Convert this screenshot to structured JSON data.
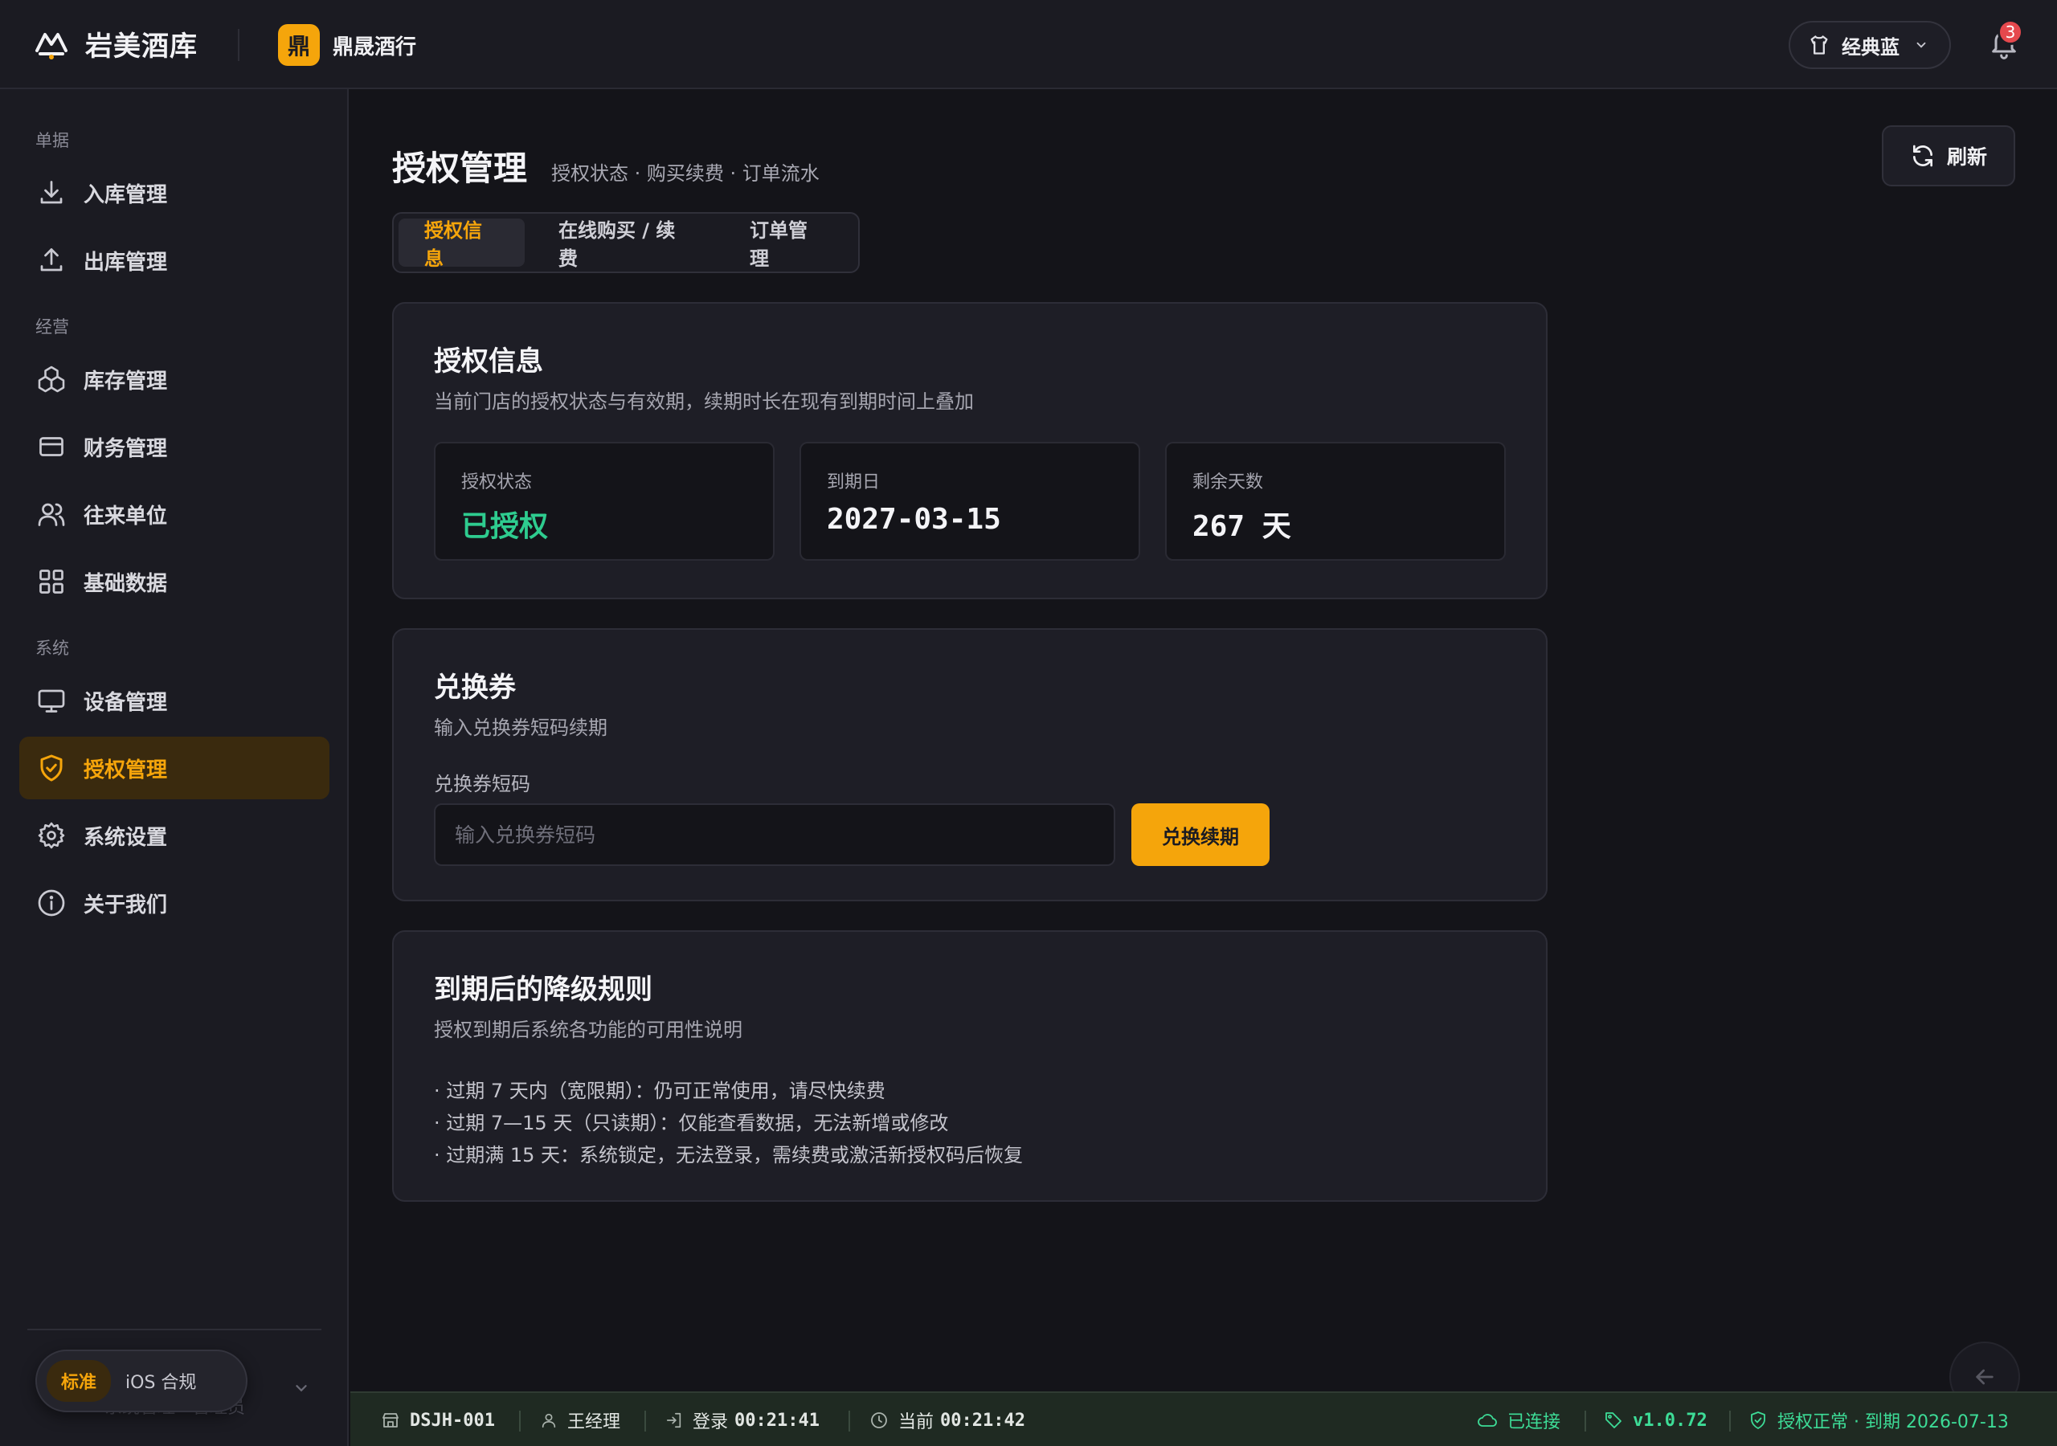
{
  "app": {
    "name": "岩美酒库",
    "store_logo": "鼎",
    "store_name": "鼎晟酒行"
  },
  "topbar": {
    "theme_label": "经典蓝",
    "notification_count": "3"
  },
  "sidebar": {
    "sections": {
      "documents": "单据",
      "business": "经营",
      "system": "系统"
    },
    "items": [
      {
        "label": "入库管理",
        "icon": "download-icon"
      },
      {
        "label": "出库管理",
        "icon": "upload-icon"
      },
      {
        "label": "库存管理",
        "icon": "boxes-icon"
      },
      {
        "label": "财务管理",
        "icon": "credit-card-icon"
      },
      {
        "label": "往来单位",
        "icon": "users-icon"
      },
      {
        "label": "基础数据",
        "icon": "grid-icon"
      },
      {
        "label": "设备管理",
        "icon": "monitor-icon"
      },
      {
        "label": "授权管理",
        "icon": "shield-check-icon",
        "active": true
      },
      {
        "label": "系统设置",
        "icon": "gear-icon"
      },
      {
        "label": "关于我们",
        "icon": "info-icon"
      }
    ],
    "user_ghost": "系统管理 · 管理员",
    "mode_toggle": {
      "standard": "标准",
      "ios": "iOS 合规",
      "selected": "标准"
    }
  },
  "main": {
    "title": "授权管理",
    "subtitle": "授权状态 · 购买续费 · 订单流水",
    "refresh_label": "刷新",
    "tabs": [
      "授权信息",
      "在线购买 / 续费",
      "订单管理"
    ],
    "active_tab": "授权信息",
    "license_card": {
      "title": "授权信息",
      "desc": "当前门店的授权状态与有效期，续期时长在现有到期时间上叠加",
      "status_label": "授权状态",
      "status_value": "已授权",
      "expiry_label": "到期日",
      "expiry_value": "2027-03-15",
      "days_label": "剩余天数",
      "days_value": "267 天"
    },
    "voucher_card": {
      "title": "兑换券",
      "desc": "输入兑换券短码续期",
      "field_label": "兑换券短码",
      "placeholder": "输入兑换券短码",
      "value": "",
      "button": "兑换续期"
    },
    "rules_card": {
      "title": "到期后的降级规则",
      "desc": "授权到期后系统各功能的可用性说明",
      "rules": [
        "· 过期 7 天内（宽限期）：仍可正常使用，请尽快续费",
        "· 过期 7—15 天（只读期）：仅能查看数据，无法新增或修改",
        "· 过期满 15 天：系统锁定，无法登录，需续费或激活新授权码后恢复"
      ]
    }
  },
  "statusbar": {
    "device": "DSJH-001",
    "user": "王经理",
    "login_label": "登录",
    "login_time": "00:21:41",
    "current_label": "当前",
    "current_time": "00:21:42",
    "connection": "已连接",
    "version": "v1.0.72",
    "license_status": "授权正常 · 到期 2026-07-13"
  },
  "colors": {
    "accent": "#f5a50b",
    "success": "#2ecc8f",
    "badge": "#e5484d",
    "statusbar_bg": "#1f2a22"
  }
}
